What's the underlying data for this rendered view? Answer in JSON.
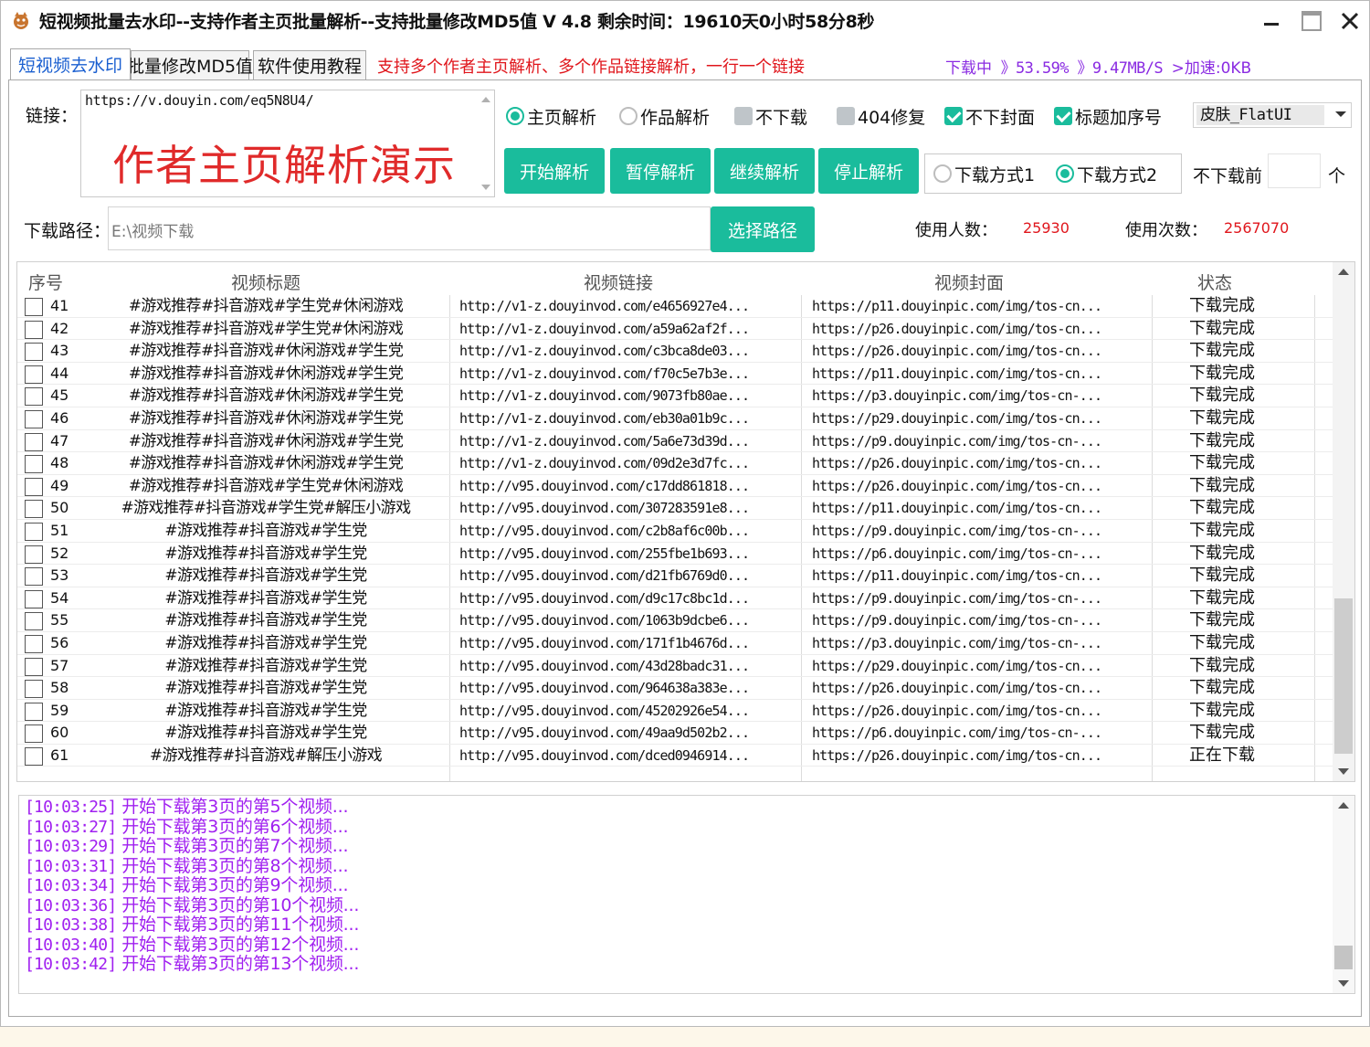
{
  "window": {
    "title": "短视频批量去水印--支持作者主页批量解析--支持批量修改MD5值 V 4.8    剩余时间：19610天0小时58分8秒"
  },
  "tabs": [
    {
      "label": "短视频去水印",
      "active": true
    },
    {
      "label": "批量修改MD5值",
      "active": false
    },
    {
      "label": "软件使用教程",
      "active": false
    }
  ],
  "notice": "支持多个作者主页解析、多个作品链接解析，一行一个链接",
  "download_status": {
    "label": "下载中",
    "percent": "》53.59%",
    "speed": "》9.47MB/S",
    "boost": ">加速:0KB"
  },
  "link": {
    "label": "链接：",
    "value": "https://v.douyin.com/eq5N8U4/",
    "demo_text": "作者主页解析演示"
  },
  "options": {
    "home_parse": "主页解析",
    "work_parse": "作品解析",
    "no_download": "不下载",
    "fix_404": "404修复",
    "no_cover": "不下封面",
    "title_seq": "标题加序号"
  },
  "skin": {
    "value": "皮肤_FlatUI"
  },
  "buttons": {
    "start": "开始解析",
    "pause": "暂停解析",
    "resume": "继续解析",
    "stop": "停止解析",
    "choose_path": "选择路径"
  },
  "download_mode": {
    "mode1": "下载方式1",
    "mode2": "下载方式2"
  },
  "skip_before": {
    "label": "不下载前",
    "value": "",
    "unit": "个"
  },
  "path": {
    "label": "下载路径：",
    "value": "E:\\视频下载"
  },
  "stats": {
    "users_label": "使用人数：",
    "users_value": "25930",
    "uses_label": "使用次数：",
    "uses_value": "2567070"
  },
  "table": {
    "headers": {
      "no": "序号",
      "title": "视频标题",
      "link": "视频链接",
      "cover": "视频封面",
      "status": "状态"
    },
    "rows": [
      {
        "no": "41",
        "title": "#游戏推荐#抖音游戏#学生党#休闲游戏",
        "link": "http://v1-z.douyinvod.com/e4656927e4...",
        "cover": "https://p11.douyinpic.com/img/tos-cn...",
        "status": "下载完成"
      },
      {
        "no": "42",
        "title": "#游戏推荐#抖音游戏#学生党#休闲游戏",
        "link": "http://v1-z.douyinvod.com/a59a62af2f...",
        "cover": "https://p26.douyinpic.com/img/tos-cn...",
        "status": "下载完成"
      },
      {
        "no": "43",
        "title": "#游戏推荐#抖音游戏#休闲游戏#学生党",
        "link": "http://v1-z.douyinvod.com/c3bca8de03...",
        "cover": "https://p26.douyinpic.com/img/tos-cn...",
        "status": "下载完成"
      },
      {
        "no": "44",
        "title": "#游戏推荐#抖音游戏#休闲游戏#学生党",
        "link": "http://v1-z.douyinvod.com/f70c5e7b3e...",
        "cover": "https://p11.douyinpic.com/img/tos-cn...",
        "status": "下载完成"
      },
      {
        "no": "45",
        "title": "#游戏推荐#抖音游戏#休闲游戏#学生党",
        "link": "http://v1-z.douyinvod.com/9073fb80ae...",
        "cover": "https://p3.douyinpic.com/img/tos-cn-...",
        "status": "下载完成"
      },
      {
        "no": "46",
        "title": "#游戏推荐#抖音游戏#休闲游戏#学生党",
        "link": "http://v1-z.douyinvod.com/eb30a01b9c...",
        "cover": "https://p29.douyinpic.com/img/tos-cn...",
        "status": "下载完成"
      },
      {
        "no": "47",
        "title": "#游戏推荐#抖音游戏#休闲游戏#学生党",
        "link": "http://v1-z.douyinvod.com/5a6e73d39d...",
        "cover": "https://p9.douyinpic.com/img/tos-cn-...",
        "status": "下载完成"
      },
      {
        "no": "48",
        "title": "#游戏推荐#抖音游戏#休闲游戏#学生党",
        "link": "http://v1-z.douyinvod.com/09d2e3d7fc...",
        "cover": "https://p26.douyinpic.com/img/tos-cn...",
        "status": "下载完成"
      },
      {
        "no": "49",
        "title": "#游戏推荐#抖音游戏#学生党#休闲游戏",
        "link": "http://v95.douyinvod.com/c17dd861818...",
        "cover": "https://p26.douyinpic.com/img/tos-cn...",
        "status": "下载完成"
      },
      {
        "no": "50",
        "title": "#游戏推荐#抖音游戏#学生党#解压小游戏",
        "link": "http://v95.douyinvod.com/307283591e8...",
        "cover": "https://p11.douyinpic.com/img/tos-cn...",
        "status": "下载完成"
      },
      {
        "no": "51",
        "title": "#游戏推荐#抖音游戏#学生党",
        "link": "http://v95.douyinvod.com/c2b8af6c00b...",
        "cover": "https://p9.douyinpic.com/img/tos-cn-...",
        "status": "下载完成"
      },
      {
        "no": "52",
        "title": "#游戏推荐#抖音游戏#学生党",
        "link": "http://v95.douyinvod.com/255fbe1b693...",
        "cover": "https://p6.douyinpic.com/img/tos-cn-...",
        "status": "下载完成"
      },
      {
        "no": "53",
        "title": "#游戏推荐#抖音游戏#学生党",
        "link": "http://v95.douyinvod.com/d21fb6769d0...",
        "cover": "https://p11.douyinpic.com/img/tos-cn...",
        "status": "下载完成"
      },
      {
        "no": "54",
        "title": "#游戏推荐#抖音游戏#学生党",
        "link": "http://v95.douyinvod.com/d9c17c8bc1d...",
        "cover": "https://p9.douyinpic.com/img/tos-cn-...",
        "status": "下载完成"
      },
      {
        "no": "55",
        "title": "#游戏推荐#抖音游戏#学生党",
        "link": "http://v95.douyinvod.com/1063b9dcbe6...",
        "cover": "https://p9.douyinpic.com/img/tos-cn-...",
        "status": "下载完成"
      },
      {
        "no": "56",
        "title": "#游戏推荐#抖音游戏#学生党",
        "link": "http://v95.douyinvod.com/171f1b4676d...",
        "cover": "https://p3.douyinpic.com/img/tos-cn-...",
        "status": "下载完成"
      },
      {
        "no": "57",
        "title": "#游戏推荐#抖音游戏#学生党",
        "link": "http://v95.douyinvod.com/43d28badc31...",
        "cover": "https://p29.douyinpic.com/img/tos-cn...",
        "status": "下载完成"
      },
      {
        "no": "58",
        "title": "#游戏推荐#抖音游戏#学生党",
        "link": "http://v95.douyinvod.com/964638a383e...",
        "cover": "https://p26.douyinpic.com/img/tos-cn...",
        "status": "下载完成"
      },
      {
        "no": "59",
        "title": "#游戏推荐#抖音游戏#学生党",
        "link": "http://v95.douyinvod.com/45202926e54...",
        "cover": "https://p26.douyinpic.com/img/tos-cn...",
        "status": "下载完成"
      },
      {
        "no": "60",
        "title": "#游戏推荐#抖音游戏#学生党",
        "link": "http://v95.douyinvod.com/49aa9d502b2...",
        "cover": "https://p6.douyinpic.com/img/tos-cn-...",
        "status": "下载完成"
      },
      {
        "no": "61",
        "title": "#游戏推荐#抖音游戏#解压小游戏",
        "link": "http://v95.douyinvod.com/dced0946914...",
        "cover": "https://p26.douyinpic.com/img/tos-cn...",
        "status": "正在下载"
      }
    ]
  },
  "log": [
    {
      "time": "[10:03:25]",
      "msg": "开始下载第3页的第5个视频..."
    },
    {
      "time": "[10:03:27]",
      "msg": "开始下载第3页的第6个视频..."
    },
    {
      "time": "[10:03:29]",
      "msg": "开始下载第3页的第7个视频..."
    },
    {
      "time": "[10:03:31]",
      "msg": "开始下载第3页的第8个视频..."
    },
    {
      "time": "[10:03:34]",
      "msg": "开始下载第3页的第9个视频..."
    },
    {
      "time": "[10:03:36]",
      "msg": "开始下载第3页的第10个视频..."
    },
    {
      "time": "[10:03:38]",
      "msg": "开始下载第3页的第11个视频..."
    },
    {
      "time": "[10:03:40]",
      "msg": "开始下载第3页的第12个视频..."
    },
    {
      "time": "[10:03:42]",
      "msg": "开始下载第3页的第13个视频..."
    }
  ],
  "colors": {
    "accent": "#1abc9c",
    "notice": "#e0161c",
    "log": "#a020f0",
    "active_tab": "#1a5fd0"
  },
  "icons": {
    "app": "app-icon",
    "minimize": "minimize-icon",
    "maximize": "maximize-icon",
    "close": "close-icon"
  }
}
